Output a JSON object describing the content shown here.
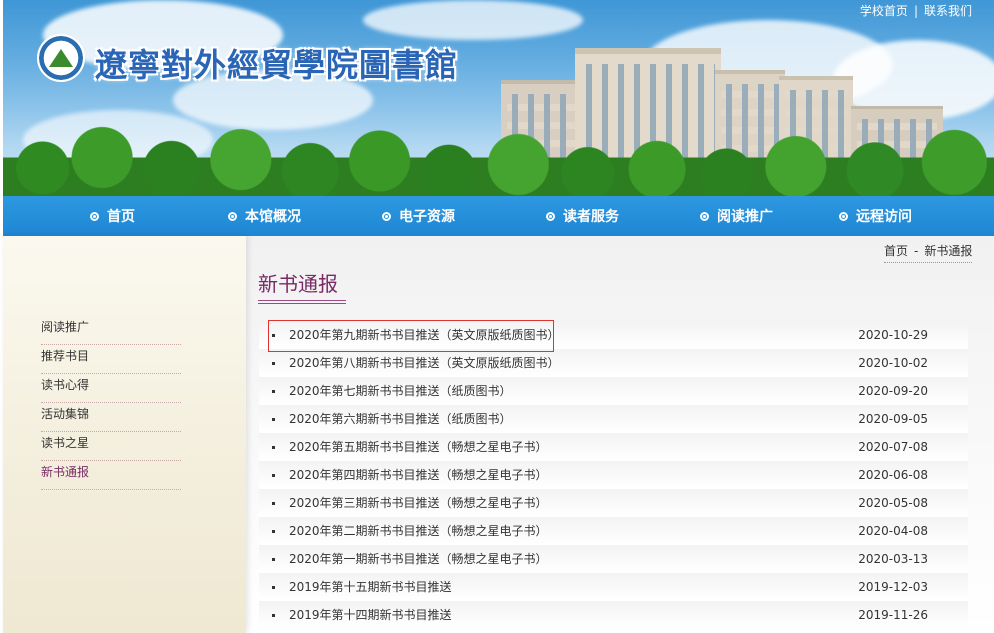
{
  "header": {
    "site_title": "遼寧對外經貿學院圖書館",
    "top_links": [
      "学校首页",
      "联系我们"
    ],
    "top_links_separator": "|"
  },
  "nav": {
    "items": [
      {
        "label": "首页"
      },
      {
        "label": "本馆概况"
      },
      {
        "label": "电子资源"
      },
      {
        "label": "读者服务"
      },
      {
        "label": "阅读推广"
      },
      {
        "label": "远程访问"
      }
    ]
  },
  "sidebar": {
    "items": [
      {
        "label": "阅读推广"
      },
      {
        "label": "推荐书目"
      },
      {
        "label": "读书心得"
      },
      {
        "label": "活动集锦"
      },
      {
        "label": "读书之星"
      },
      {
        "label": "新书通报"
      }
    ],
    "active_index": 5
  },
  "breadcrumb": {
    "items": [
      "首页",
      "新书通报"
    ],
    "separator": "-"
  },
  "main": {
    "section_title": "新书通报",
    "list": [
      {
        "title": "2020年第九期新书书目推送（英文原版纸质图书）",
        "date": "2020-10-29"
      },
      {
        "title": "2020年第八期新书书目推送（英文原版纸质图书）",
        "date": "2020-10-02"
      },
      {
        "title": "2020年第七期新书书目推送（纸质图书）",
        "date": "2020-09-20"
      },
      {
        "title": "2020年第六期新书书目推送（纸质图书）",
        "date": "2020-09-05"
      },
      {
        "title": "2020年第五期新书书目推送（畅想之星电子书）",
        "date": "2020-07-08"
      },
      {
        "title": "2020年第四期新书书目推送（畅想之星电子书）",
        "date": "2020-06-08"
      },
      {
        "title": "2020年第三期新书书目推送（畅想之星电子书）",
        "date": "2020-05-08"
      },
      {
        "title": "2020年第二期新书书目推送（畅想之星电子书）",
        "date": "2020-04-08"
      },
      {
        "title": "2020年第一期新书书目推送（畅想之星电子书）",
        "date": "2020-03-13"
      },
      {
        "title": "2019年第十五期新书书目推送",
        "date": "2019-12-03"
      },
      {
        "title": "2019年第十四期新书书目推送",
        "date": "2019-11-26"
      }
    ]
  },
  "colors": {
    "nav_bg": "#1e86d3",
    "accent_purple": "#7a2a66",
    "highlight_red": "#e0322f",
    "title_blue": "#2a66b5"
  },
  "icons": {
    "logo": "library-logo-icon",
    "nav_bullet": "circle-dot-icon",
    "list_bullet": "square-bullet-icon"
  }
}
